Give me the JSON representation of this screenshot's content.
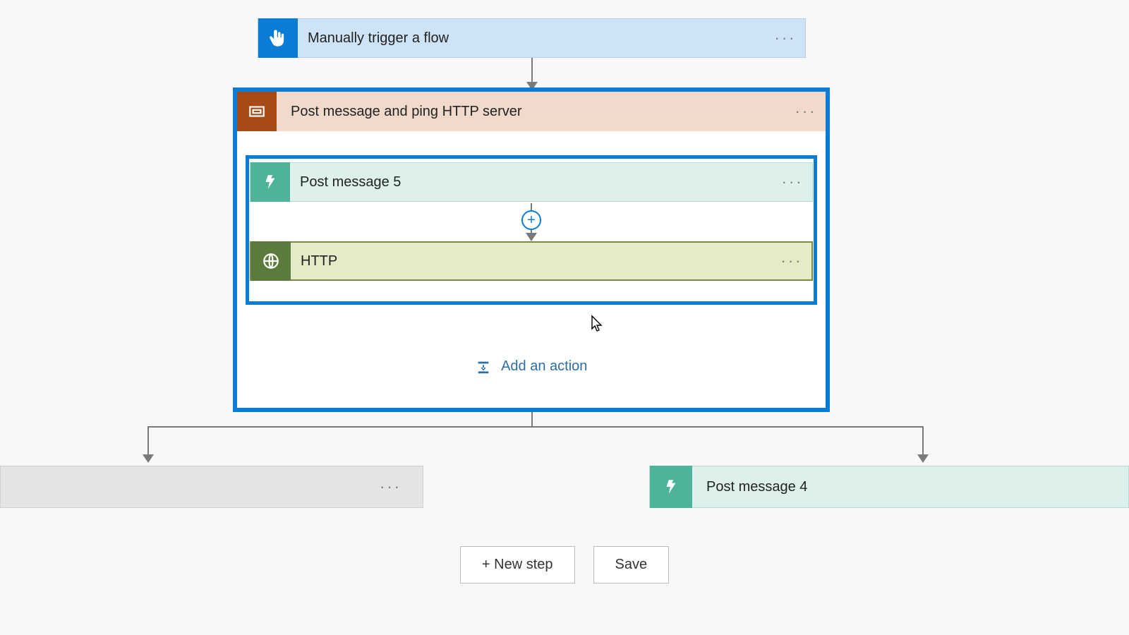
{
  "trigger": {
    "title": "Manually trigger a flow"
  },
  "scope": {
    "title": "Post message and ping HTTP server",
    "actions": [
      {
        "title": "Post message 5"
      },
      {
        "title": "HTTP"
      }
    ],
    "add_action_label": "Add an action"
  },
  "branches": {
    "left": {
      "title": ""
    },
    "right": {
      "title": "Post message 4"
    }
  },
  "footer": {
    "new_step": "+ New step",
    "save": "Save"
  },
  "colors": {
    "selection": "#0a7cd6",
    "trigger_icon_bg": "#0a7cd6",
    "scope_icon_bg": "#a84a16",
    "slack_icon_bg": "#4fb39b",
    "http_icon_bg": "#5d7a3d"
  }
}
